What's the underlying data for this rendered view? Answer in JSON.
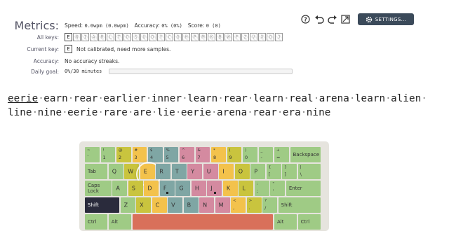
{
  "toolbar": {
    "settings_label": "SETTINGS...",
    "icons": [
      "help-icon",
      "undo-icon",
      "redo-icon",
      "fullscreen-icon",
      "gear-icon"
    ]
  },
  "metrics": {
    "label": "Metrics:",
    "speed_label": "Speed:",
    "speed_value": "0.0wpm (0.0wpm)",
    "accuracy_label": "Accuracy:",
    "accuracy_value": "0% (0%)",
    "score_label": "Score:",
    "score_value": "0 (0)"
  },
  "all_keys": {
    "label": "All keys:",
    "keys": [
      "E",
      "N",
      "I",
      "A",
      "R",
      "L",
      "T",
      "O",
      "S",
      "U",
      "D",
      "Y",
      "C",
      "G",
      "H",
      "P",
      "M",
      "K",
      "B",
      "W",
      "F",
      "Z",
      "V",
      "X",
      "Q",
      "J"
    ]
  },
  "current_key": {
    "label": "Current key:",
    "key": "E",
    "text": "Not calibrated, need more samples."
  },
  "accuracy": {
    "label": "Accuracy:",
    "text": "No accuracy streaks."
  },
  "daily_goal": {
    "label": "Daily goal:",
    "text": "0%/30 minutes",
    "progress": 0
  },
  "text": {
    "line1": [
      "eerie",
      "earn",
      "rear",
      "earlier",
      "inner",
      "learn",
      "rear",
      "learn",
      "real",
      "arena",
      "learn",
      "alien"
    ],
    "line2": [
      "line",
      "nine",
      "eerie",
      "rare",
      "are",
      "lie",
      "eerie",
      "arena",
      "rear",
      "era",
      "nine"
    ]
  },
  "colors": {
    "green": "#9fcb85",
    "yellow": "#f3c24c",
    "teal": "#7fa6a4",
    "pink": "#d48aa0",
    "olive": "#c9c43e",
    "dark": "#2a2b3c",
    "orange": "#d9705a"
  },
  "keyboard": {
    "rows": [
      [
        {
          "t": "~",
          "b": "`",
          "c": "green"
        },
        {
          "t": "!",
          "b": "1",
          "c": "green"
        },
        {
          "t": "@",
          "b": "2",
          "c": "olive"
        },
        {
          "t": "#",
          "b": "3",
          "c": "yellow"
        },
        {
          "t": "$",
          "b": "4",
          "c": "teal"
        },
        {
          "t": "%",
          "b": "5",
          "c": "teal"
        },
        {
          "t": "^",
          "b": "6",
          "c": "pink"
        },
        {
          "t": "&",
          "b": "7",
          "c": "pink"
        },
        {
          "t": "*",
          "b": "8",
          "c": "yellow"
        },
        {
          "t": "(",
          "b": "9",
          "c": "olive"
        },
        {
          "t": ")",
          "b": "0",
          "c": "green"
        },
        {
          "t": "_",
          "b": "-",
          "c": "green"
        },
        {
          "t": "+",
          "b": "=",
          "c": "green"
        },
        {
          "m": "Backspace",
          "c": "green",
          "w": 2
        }
      ],
      [
        {
          "m": "Tab",
          "c": "green",
          "w": 1.5
        },
        {
          "m": "Q",
          "c": "green",
          "big": true
        },
        {
          "m": "W",
          "c": "olive",
          "big": true
        },
        {
          "m": "E",
          "c": "yellow",
          "big": true,
          "active": true
        },
        {
          "m": "R",
          "c": "teal",
          "big": true
        },
        {
          "m": "T",
          "c": "teal",
          "big": true
        },
        {
          "m": "Y",
          "c": "pink",
          "big": true
        },
        {
          "m": "U",
          "c": "pink",
          "big": true
        },
        {
          "m": "I",
          "c": "yellow",
          "big": true
        },
        {
          "m": "O",
          "c": "olive",
          "big": true
        },
        {
          "m": "P",
          "c": "green",
          "big": true
        },
        {
          "t": "{",
          "b": "[",
          "c": "green"
        },
        {
          "t": "}",
          "b": "]",
          "c": "green"
        },
        {
          "t": "|",
          "b": "\\",
          "c": "green",
          "w": 1.5
        }
      ],
      [
        {
          "m": "Caps Lock",
          "c": "green",
          "w": 1.75
        },
        {
          "m": "A",
          "c": "green",
          "big": true
        },
        {
          "m": "S",
          "c": "olive",
          "big": true
        },
        {
          "m": "D",
          "c": "yellow",
          "big": true
        },
        {
          "m": "F",
          "c": "teal",
          "big": true,
          "dot": true
        },
        {
          "m": "G",
          "c": "teal",
          "big": true
        },
        {
          "m": "H",
          "c": "pink",
          "big": true
        },
        {
          "m": "J",
          "c": "pink",
          "big": true,
          "dot": true
        },
        {
          "m": "K",
          "c": "yellow",
          "big": true
        },
        {
          "m": "L",
          "c": "olive",
          "big": true
        },
        {
          "t": ":",
          "b": ";",
          "c": "green"
        },
        {
          "t": "\"",
          "b": "'",
          "c": "green"
        },
        {
          "m": "Enter",
          "c": "green",
          "w": 2.25
        }
      ],
      [
        {
          "m": "Shift",
          "c": "dark",
          "w": 2.25
        },
        {
          "m": "Z",
          "c": "green",
          "big": true
        },
        {
          "m": "X",
          "c": "olive",
          "big": true
        },
        {
          "m": "C",
          "c": "yellow",
          "big": true
        },
        {
          "m": "V",
          "c": "teal",
          "big": true
        },
        {
          "m": "B",
          "c": "teal",
          "big": true
        },
        {
          "m": "N",
          "c": "pink",
          "big": true
        },
        {
          "m": "M",
          "c": "pink",
          "big": true
        },
        {
          "t": "<",
          "b": ",",
          "c": "yellow"
        },
        {
          "t": ">",
          "b": ".",
          "c": "olive"
        },
        {
          "t": "?",
          "b": "/",
          "c": "green"
        },
        {
          "m": "Shift",
          "c": "green",
          "w": 2.75
        }
      ],
      [
        {
          "m": "Ctrl",
          "c": "green",
          "w": 1.5
        },
        {
          "m": "Alt",
          "c": "green",
          "w": 1.5
        },
        {
          "m": "",
          "c": "orange",
          "w": 9
        },
        {
          "m": "Alt",
          "c": "green",
          "w": 1.5
        },
        {
          "m": "Ctrl",
          "c": "green",
          "w": 1.5
        }
      ]
    ]
  }
}
